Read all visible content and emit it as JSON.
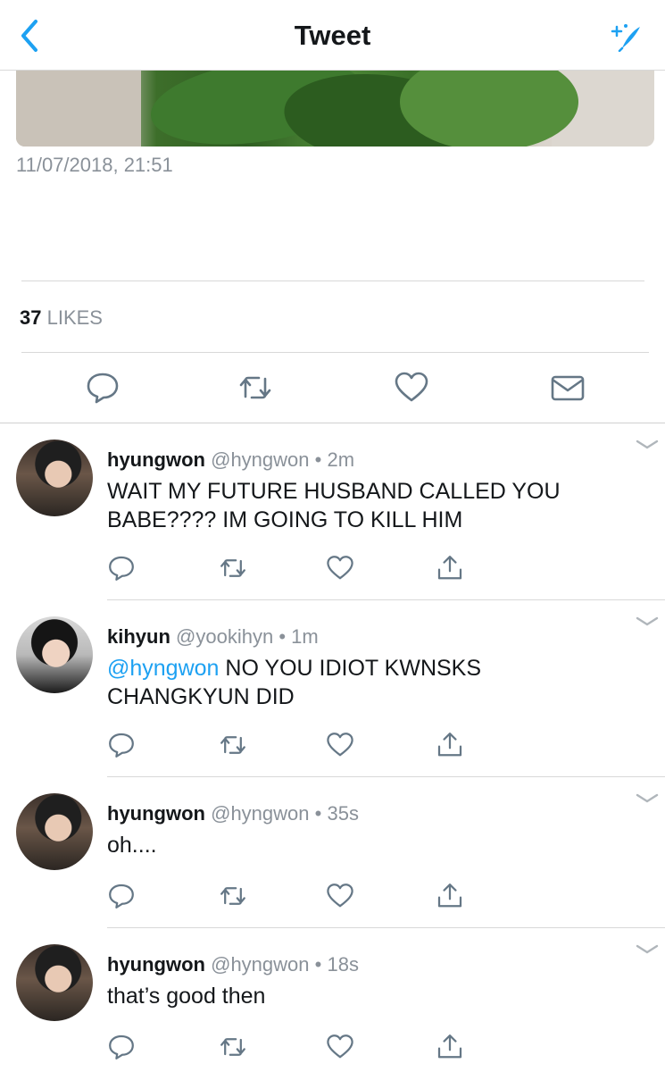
{
  "header": {
    "title": "Tweet",
    "back_icon": "chevron-left-icon",
    "compose_icon": "sparkle-compose-icon",
    "accent": "#1da1f2"
  },
  "tweet": {
    "timestamp": "11/07/2018, 21:51",
    "likes_count": "37",
    "likes_label": "LIKES"
  },
  "main_actions": [
    "reply-icon",
    "retweet-icon",
    "like-icon",
    "message-icon"
  ],
  "replies": [
    {
      "name": "hyungwon",
      "handle": "@hyngwon",
      "dot": "•",
      "time": "2m",
      "mention": "",
      "text": "WAIT MY FUTURE HUSBAND CALLED YOU BABE???? IM GOING TO KILL HIM"
    },
    {
      "name": "kihyun",
      "handle": "@yookihyn",
      "dot": "•",
      "time": "1m",
      "mention": "@hyngwon",
      "text": " NO YOU IDIOT KWNSKS CHANGKYUN DID"
    },
    {
      "name": "hyungwon",
      "handle": "@hyngwon",
      "dot": "•",
      "time": "35s",
      "mention": "",
      "text": "oh...."
    },
    {
      "name": "hyungwon",
      "handle": "@hyngwon",
      "dot": "•",
      "time": "18s",
      "mention": "",
      "text": "that’s good then"
    }
  ]
}
